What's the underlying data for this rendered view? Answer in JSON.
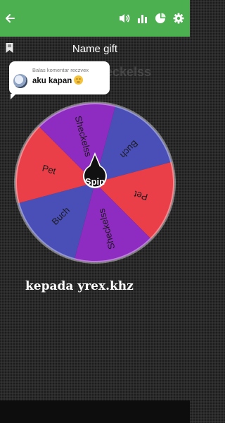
{
  "page": {
    "title": "Name gift",
    "ghost_title": "eckelss"
  },
  "comment": {
    "header": "Balas komentar reczvex",
    "text": "aku kapan"
  },
  "wheel": {
    "center_label": "Spin",
    "segments": [
      {
        "label": "Buch",
        "color": "#4a4fb8"
      },
      {
        "label": "Pet",
        "color": "#ea3e48"
      },
      {
        "label": "Sheckelss",
        "color": "#8e2bc1"
      },
      {
        "label": "Buch",
        "color": "#4a4fb8"
      },
      {
        "label": "Pet",
        "color": "#ea3e48"
      },
      {
        "label": "Sheckelss",
        "color": "#8e2bc1"
      }
    ]
  },
  "caption": "kepada yrex.khz",
  "icons": {
    "back": "arrow-left-icon",
    "sound": "volume-icon",
    "stats": "bar-chart-icon",
    "pie": "pie-chart-icon",
    "settings": "gear-icon",
    "bookmark": "bookmark-icon",
    "emoji": "smirk-emoji-icon"
  },
  "colors": {
    "appbar": "#4caf50",
    "background": "#2a2a2a"
  }
}
